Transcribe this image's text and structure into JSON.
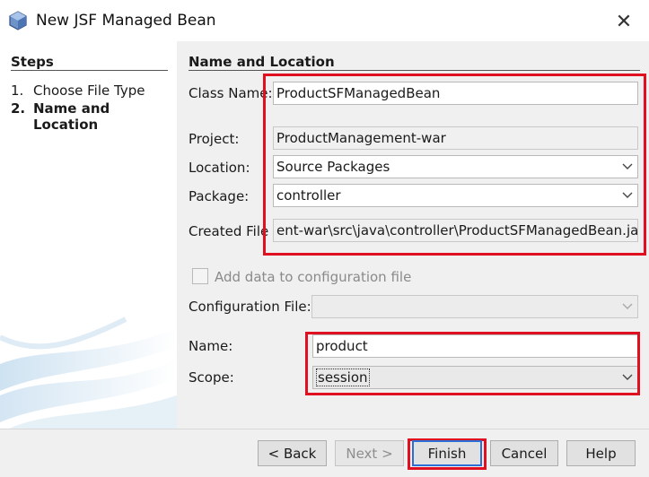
{
  "window": {
    "title": "New JSF Managed Bean",
    "close_glyph": "✕"
  },
  "steps": {
    "heading": "Steps",
    "items": [
      {
        "num": "1.",
        "label": "Choose File Type",
        "active": false
      },
      {
        "num": "2.",
        "label": "Name and Location",
        "active": true
      }
    ]
  },
  "form": {
    "heading": "Name and Location",
    "class_name": {
      "label": "Class Name:",
      "value": "ProductSFManagedBean"
    },
    "project": {
      "label": "Project:",
      "value": "ProductManagement-war"
    },
    "location": {
      "label": "Location:",
      "value": "Source Packages"
    },
    "package": {
      "label": "Package:",
      "value": "controller"
    },
    "created_file": {
      "label": "Created File",
      "value": "ent-war\\src\\java\\controller\\ProductSFManagedBean.java"
    },
    "add_config": {
      "label": "Add data to configuration file",
      "checked": false
    },
    "config_file": {
      "label": "Configuration File:",
      "value": ""
    },
    "name": {
      "label": "Name:",
      "value": "product"
    },
    "scope": {
      "label": "Scope:",
      "value": "session"
    }
  },
  "buttons": {
    "back": "< Back",
    "next": "Next >",
    "finish": "Finish",
    "cancel": "Cancel",
    "help": "Help"
  },
  "colors": {
    "highlight": "#e01020",
    "accent": "#2a6fd6"
  }
}
